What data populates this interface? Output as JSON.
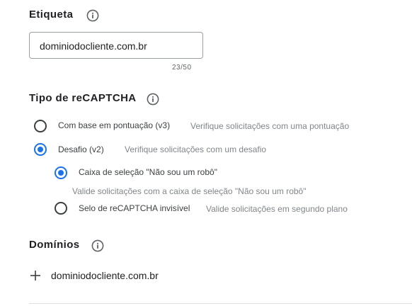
{
  "label_section": {
    "title": "Etiqueta",
    "input_value": "dominiodocliente.com.br",
    "char_count": "23/50"
  },
  "recaptcha_section": {
    "title": "Tipo de reCAPTCHA",
    "options": [
      {
        "label": "Com base em pontuação (v3)",
        "description": "Verifique solicitações com uma pontuação",
        "selected": false
      },
      {
        "label": "Desafio (v2)",
        "description": "Verifique solicitações com um desafio",
        "selected": true
      }
    ],
    "sub_options": [
      {
        "label": "Caixa de seleção \"Não sou um robô\"",
        "description": "Valide solicitações com a caixa de seleção \"Não sou um robô\"",
        "selected": true
      },
      {
        "label": "Selo de reCAPTCHA invisível",
        "description": "Valide solicitações em segundo plano",
        "selected": false
      }
    ]
  },
  "domains_section": {
    "title": "Domínios",
    "domains": [
      "dominiodocliente.com.br"
    ]
  },
  "colors": {
    "accent": "#1a73e8",
    "text_primary": "#202124",
    "text_secondary": "#80868b",
    "border": "#9aa0a6"
  },
  "icons": {
    "info": "info-icon",
    "add": "plus-icon"
  }
}
